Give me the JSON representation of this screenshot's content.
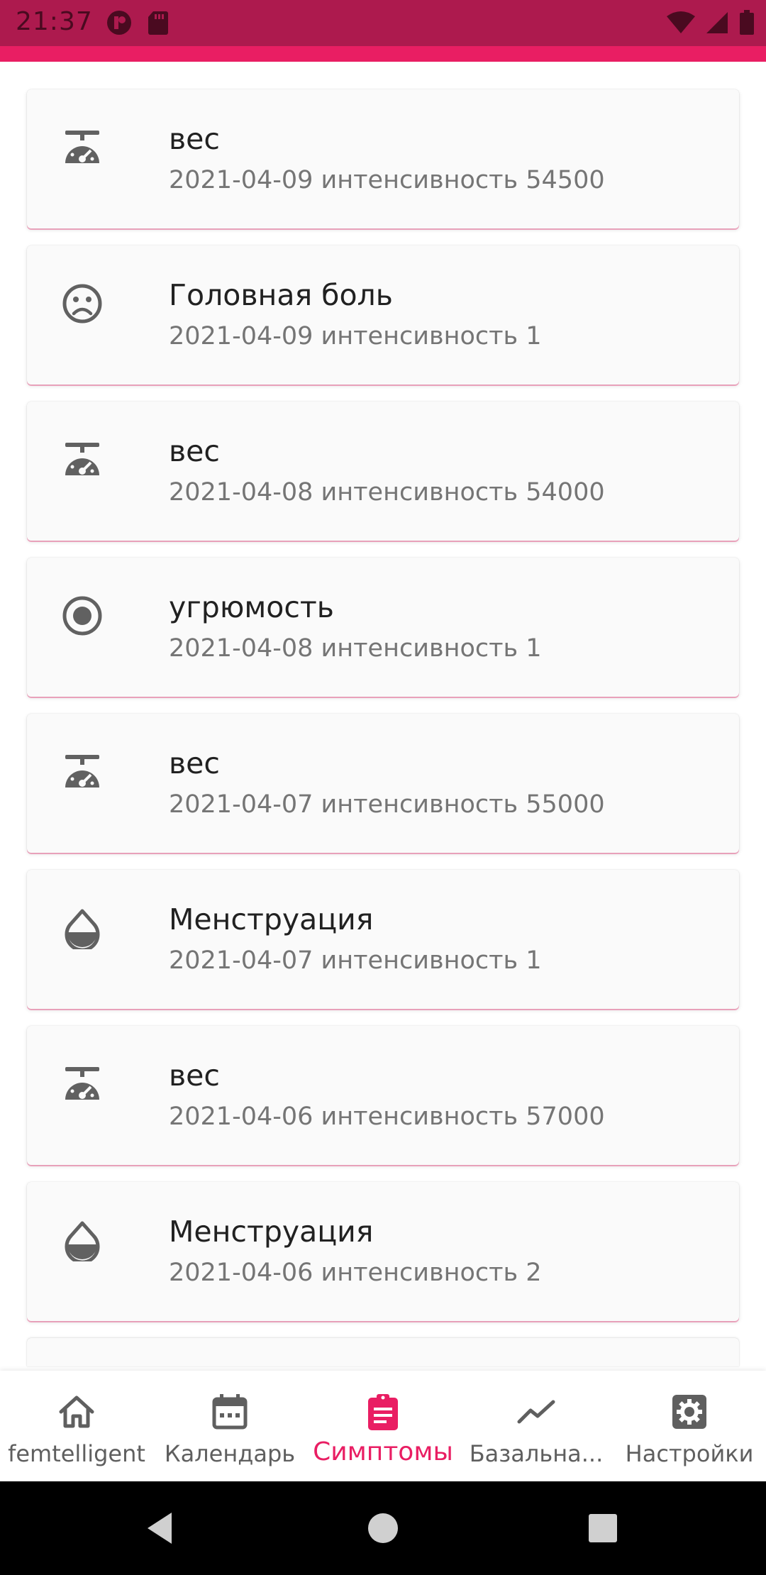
{
  "status_bar": {
    "time": "21:37",
    "background": "#ad1a4e"
  },
  "accent_color": "#e91e63",
  "items": [
    {
      "title": "вес",
      "subtitle": "2021-04-09 интенсивность 54500",
      "icon": "scale-icon"
    },
    {
      "title": "Головная боль",
      "subtitle": "2021-04-09 интенсивность 1",
      "icon": "sad-face-icon"
    },
    {
      "title": "вес",
      "subtitle": "2021-04-08 интенсивность 54000",
      "icon": "scale-icon"
    },
    {
      "title": "угрюмость",
      "subtitle": "2021-04-08 интенсивность 1",
      "icon": "radio-dot-icon"
    },
    {
      "title": "вес",
      "subtitle": "2021-04-07 интенсивность 55000",
      "icon": "scale-icon"
    },
    {
      "title": "Менструация",
      "subtitle": "2021-04-07 интенсивность 1",
      "icon": "drop-icon"
    },
    {
      "title": "вес",
      "subtitle": "2021-04-06 интенсивность 57000",
      "icon": "scale-icon"
    },
    {
      "title": "Менструация",
      "subtitle": "2021-04-06 интенсивность 2",
      "icon": "drop-icon"
    }
  ],
  "bottom_nav": [
    {
      "label": "femtelligent",
      "icon": "home-icon",
      "active": false
    },
    {
      "label": "Календарь",
      "icon": "calendar-icon",
      "active": false
    },
    {
      "label": "Симптомы",
      "icon": "clipboard-icon",
      "active": true
    },
    {
      "label": "Базальна...",
      "icon": "trend-line-icon",
      "active": false
    },
    {
      "label": "Настройки",
      "icon": "settings-gear-icon",
      "active": false
    }
  ]
}
